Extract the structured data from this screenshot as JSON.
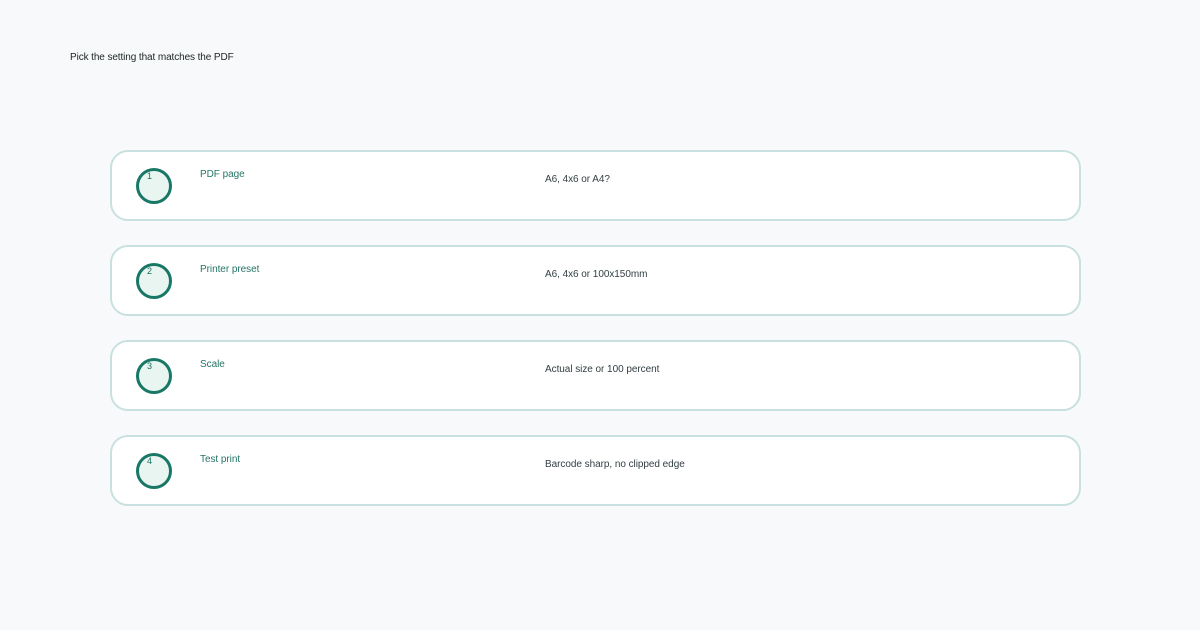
{
  "header": {
    "instruction": "Pick the setting that matches the PDF"
  },
  "steps": [
    {
      "number": "1",
      "title": "PDF page",
      "detail": "A6, 4x6 or A4?"
    },
    {
      "number": "2",
      "title": "Printer preset",
      "detail": "A6, 4x6 or 100x150mm"
    },
    {
      "number": "3",
      "title": "Scale",
      "detail": "Actual size or 100 percent"
    },
    {
      "number": "4",
      "title": "Test print",
      "detail": "Barcode sharp, no clipped edge"
    }
  ],
  "colors": {
    "background": "#f7f9fb",
    "card_border": "#c8e0df",
    "accent": "#187865",
    "accent_fill": "#e8f5f1",
    "title_text": "#247565",
    "detail_text": "#334043"
  }
}
